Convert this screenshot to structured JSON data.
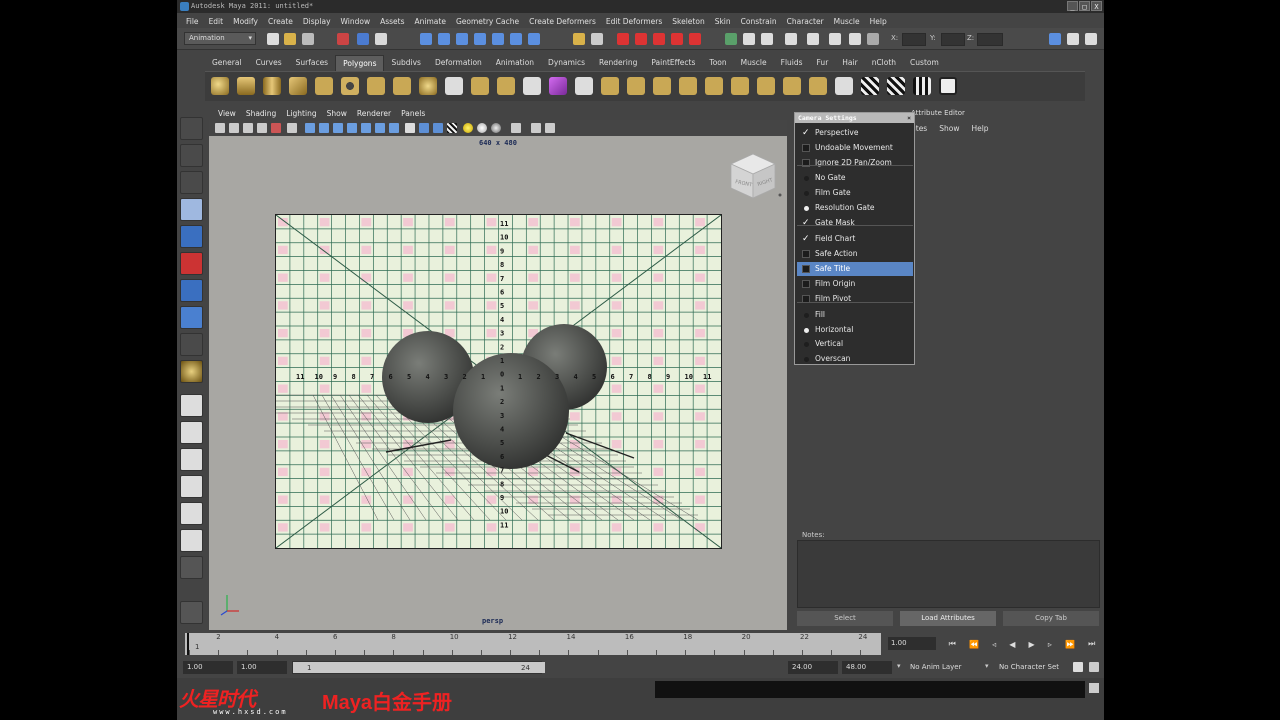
{
  "window": {
    "title": "Autodesk Maya 2011: untitled*",
    "controls": [
      "_",
      "□",
      "X"
    ]
  },
  "menubar": [
    "File",
    "Edit",
    "Modify",
    "Create",
    "Display",
    "Window",
    "Assets",
    "Animate",
    "Geometry Cache",
    "Create Deformers",
    "Edit Deformers",
    "Skeleton",
    "Skin",
    "Constrain",
    "Character",
    "Muscle",
    "Help"
  ],
  "statusline": {
    "mode": "Animation",
    "x_label": "X:",
    "y_label": "Y:",
    "z_label": "Z:"
  },
  "shelf_tabs": [
    "General",
    "Curves",
    "Surfaces",
    "Polygons",
    "Subdivs",
    "Deformation",
    "Animation",
    "Dynamics",
    "Rendering",
    "PaintEffects",
    "Toon",
    "Muscle",
    "Fluids",
    "Fur",
    "Hair",
    "nCloth",
    "Custom"
  ],
  "shelf_active": "Polygons",
  "viewport": {
    "menu": [
      "View",
      "Shading",
      "Lighting",
      "Show",
      "Renderer",
      "Panels"
    ],
    "resolution": "640 x 480",
    "camera": "persp",
    "viewcube": {
      "front": "FRONT",
      "right": "RIGHT"
    },
    "field_chart_numbers": [
      "11",
      "10",
      "9",
      "8",
      "7",
      "6",
      "5",
      "4",
      "3",
      "2",
      "1",
      "0",
      "1",
      "2",
      "3",
      "4",
      "5",
      "6",
      "7",
      "8",
      "9",
      "10",
      "11"
    ]
  },
  "camera_settings": {
    "title": "Camera Settings",
    "items": [
      {
        "label": "Perspective",
        "type": "check",
        "on": true
      },
      {
        "label": "Undoable Movement",
        "type": "check",
        "on": false
      },
      {
        "label": "Ignore 2D Pan/Zoom",
        "type": "check",
        "on": false
      },
      {
        "label": "No Gate",
        "type": "radio",
        "on": false
      },
      {
        "label": "Film Gate",
        "type": "radio",
        "on": false
      },
      {
        "label": "Resolution Gate",
        "type": "radio",
        "on": true
      },
      {
        "label": "Gate Mask",
        "type": "check",
        "on": true
      },
      {
        "label": "Field Chart",
        "type": "check",
        "on": true
      },
      {
        "label": "Safe Action",
        "type": "check",
        "on": false
      },
      {
        "label": "Safe Title",
        "type": "check",
        "on": false,
        "selected": true
      },
      {
        "label": "Film Origin",
        "type": "check",
        "on": false
      },
      {
        "label": "Film Pivot",
        "type": "check",
        "on": false
      },
      {
        "label": "Fill",
        "type": "radio",
        "on": false
      },
      {
        "label": "Horizontal",
        "type": "radio",
        "on": true
      },
      {
        "label": "Vertical",
        "type": "radio",
        "on": false
      },
      {
        "label": "Overscan",
        "type": "radio",
        "on": false
      }
    ]
  },
  "attribute_editor": {
    "title": "Attribute Editor",
    "menu": [
      "utes",
      "Show",
      "Help"
    ],
    "notes_label": "Notes:",
    "buttons": [
      "Select",
      "Load Attributes",
      "Copy Tab"
    ]
  },
  "timeline": {
    "ticks": [
      "2",
      "4",
      "6",
      "8",
      "10",
      "12",
      "14",
      "16",
      "18",
      "20",
      "22",
      "24"
    ],
    "start_marker": "1",
    "current_frame": "1.00"
  },
  "range": {
    "start": "1.00",
    "playback_start": "1.00",
    "slider_start": "1",
    "slider_end": "24",
    "playback_end": "24.00",
    "end": "48.00",
    "anim_layer": "No Anim Layer",
    "character_set": "No Character Set"
  },
  "watermark": {
    "brand": "火星时代",
    "product": "Maya白金手册",
    "url": "www.hxsd.com"
  }
}
